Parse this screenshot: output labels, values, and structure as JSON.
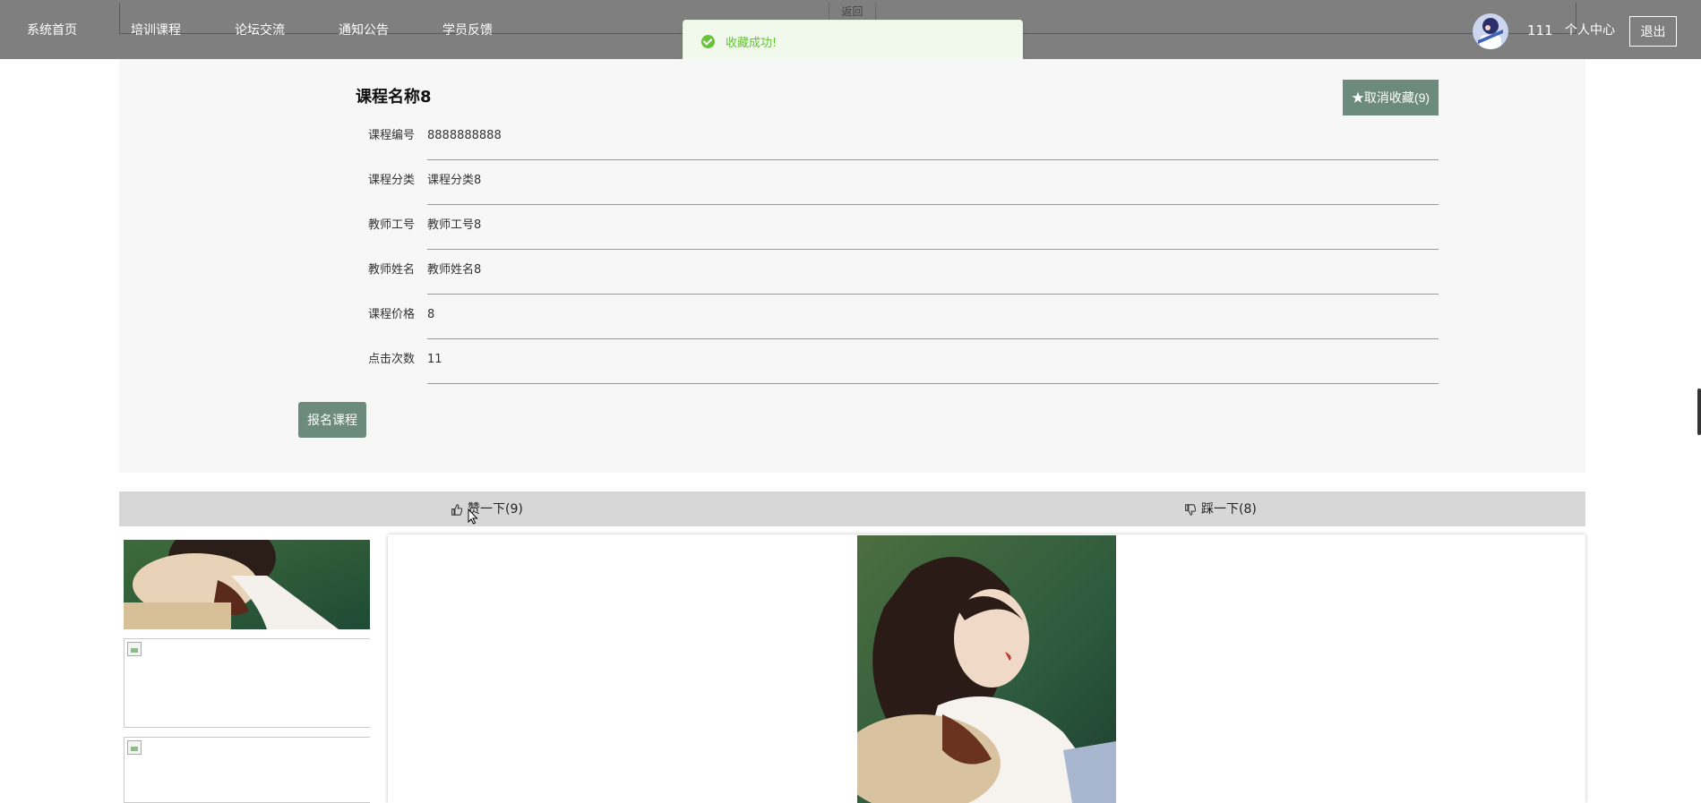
{
  "nav": {
    "items": [
      {
        "label": "系统首页"
      },
      {
        "label": "培训课程"
      },
      {
        "label": "论坛交流"
      },
      {
        "label": "通知公告"
      },
      {
        "label": "学员反馈"
      }
    ],
    "back_label": "返回",
    "username": "111",
    "profile_label": "个人中心",
    "logout_label": "退出"
  },
  "toast": {
    "message": "收藏成功!",
    "color": "#67c23a"
  },
  "course": {
    "title": "课程名称8",
    "favorite_button": "★取消收藏(9)",
    "fields": [
      {
        "label": "课程编号",
        "value": "8888888888"
      },
      {
        "label": "课程分类",
        "value": "课程分类8"
      },
      {
        "label": "教师工号",
        "value": "教师工号8"
      },
      {
        "label": "教师姓名",
        "value": "教师姓名8"
      },
      {
        "label": "课程价格",
        "value": "8"
      },
      {
        "label": "点击次数",
        "value": "11"
      }
    ],
    "enroll_button": "报名课程"
  },
  "votes": {
    "like_label": "赞一下(9)",
    "dislike_label": "踩一下(8)"
  },
  "theme": {
    "nav_bg": "#7f7f7f",
    "accent": "#6d8a7f",
    "panel_bg": "#f7f7f7",
    "vote_bar_bg": "#d7d7d7"
  }
}
